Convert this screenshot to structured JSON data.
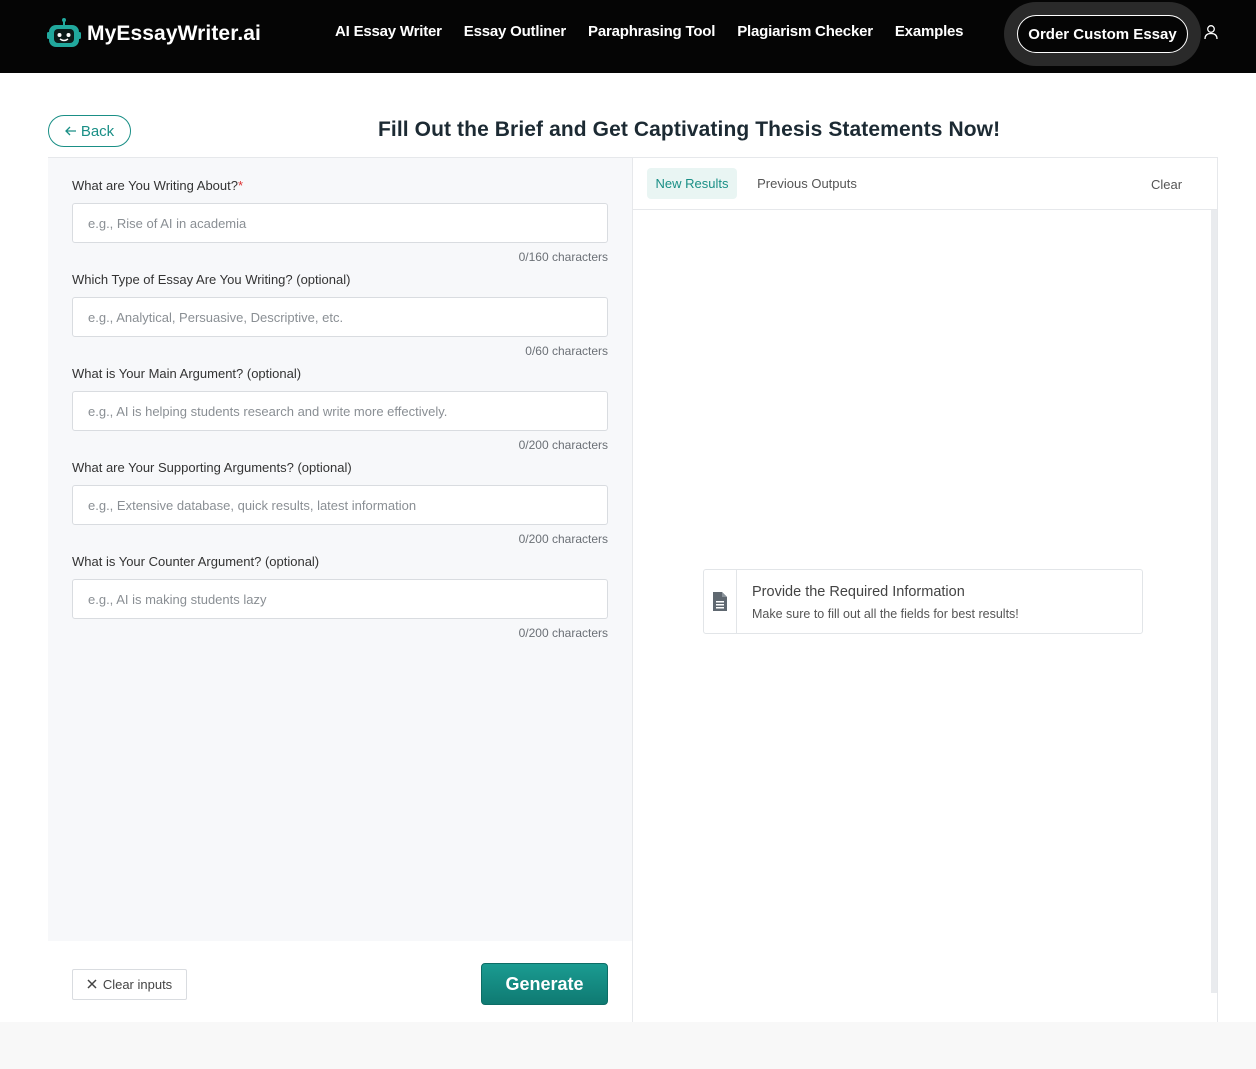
{
  "header": {
    "logo_text": "MyEssayWriter.ai",
    "nav": [
      {
        "label": "AI Essay Writer"
      },
      {
        "label": "Essay Outliner"
      },
      {
        "label": "Paraphrasing Tool"
      },
      {
        "label": "Plagiarism Checker"
      },
      {
        "label": "Examples"
      }
    ],
    "order_button": "Order Custom Essay"
  },
  "page": {
    "back_label": "Back",
    "title": "Fill Out the Brief and Get Captivating Thesis Statements Now!"
  },
  "form": {
    "fields": [
      {
        "label": "What are You Writing About?",
        "required_mark": "*",
        "placeholder": "e.g., Rise of AI in academia",
        "counter": "0/160 characters"
      },
      {
        "label": "Which Type of Essay Are You Writing? (optional)",
        "placeholder": "e.g., Analytical, Persuasive, Descriptive, etc.",
        "counter": "0/60 characters"
      },
      {
        "label": "What is Your Main Argument? (optional)",
        "placeholder": "e.g., AI is helping students research and write more effectively.",
        "counter": "0/200 characters"
      },
      {
        "label": "What are Your Supporting Arguments? (optional)",
        "placeholder": "e.g., Extensive database, quick results, latest information",
        "counter": "0/200 characters"
      },
      {
        "label": "What is Your Counter Argument? (optional)",
        "placeholder": "e.g., AI is making students lazy",
        "counter": "0/200 characters"
      }
    ],
    "clear_inputs_label": "Clear inputs",
    "generate_label": "Generate"
  },
  "results": {
    "tabs": [
      {
        "label": "New Results"
      },
      {
        "label": "Previous Outputs"
      }
    ],
    "clear_label": "Clear",
    "empty_title": "Provide the Required Information",
    "empty_subtitle": "Make sure to fill out all the fields for best results!"
  },
  "colors": {
    "accent": "#1a8f86",
    "header_bg": "#050505"
  }
}
